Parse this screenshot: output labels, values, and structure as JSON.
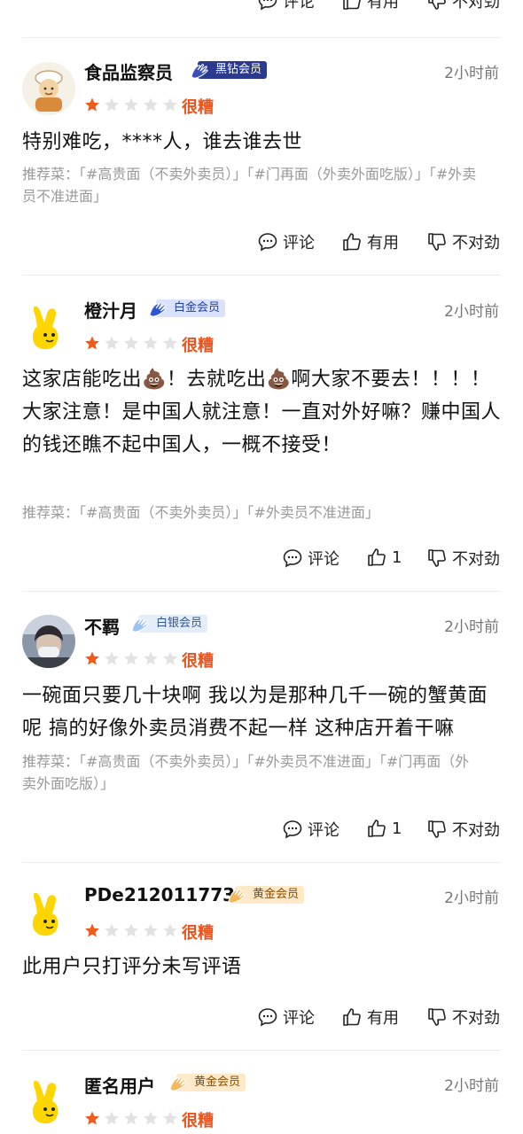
{
  "labels": {
    "comment": "评论",
    "useful": "有用",
    "not_right": "不对劲",
    "rating_text": "很糟"
  },
  "colors": {
    "star_active": "#f05a1a",
    "star_inactive": "#e2e2e2",
    "rating_text": "#e8541e"
  },
  "top_actions": {
    "comment": "评论",
    "useful": "有用",
    "not_right": "不对劲"
  },
  "reviews": [
    {
      "username": "食品监察员",
      "badge": "黑钻会员",
      "time": "2小时前",
      "stars": 1,
      "rating_text": "很糟",
      "text": "特别难吃，****人，谁去谁去世",
      "dishes": "推荐菜：「#高贵面（不卖外卖员）」「#门再面（外卖外面吃版）」「#外卖员不准进面」",
      "useful": "有用"
    },
    {
      "username": "橙汁月",
      "badge": "白金会员",
      "time": "2小时前",
      "stars": 1,
      "rating_text": "很糟",
      "text_parts": [
        "这家店能吃出",
        "💩",
        "！去就吃出",
        "💩",
        "啊大家不要去！！！！大家注意！是中国人就注意！一直对外好嘛？赚中国人的钱还瞧不起中国人，一概不接受！"
      ],
      "dishes": "推荐菜：「#高贵面（不卖外卖员）」「#外卖员不准进面」",
      "useful": "1"
    },
    {
      "username": "不羁",
      "badge": "白银会员",
      "time": "2小时前",
      "stars": 1,
      "rating_text": "很糟",
      "text": "一碗面只要几十块啊 我以为是那种几千一碗的蟹黄面呢 搞的好像外卖员消费不起一样 这种店开着干嘛",
      "dishes": "推荐菜：「#高贵面（不卖外卖员）」「#外卖员不准进面」「#门再面（外卖外面吃版）」",
      "useful": "1"
    },
    {
      "username": "PDe212011773",
      "badge": "黄金会员",
      "time": "2小时前",
      "stars": 1,
      "rating_text": "很糟",
      "text": "此用户只打评分未写评语",
      "useful": "有用"
    },
    {
      "username": "匿名用户",
      "badge": "黄金会员",
      "time": "2小时前",
      "stars": 1,
      "rating_text": "很糟"
    }
  ]
}
